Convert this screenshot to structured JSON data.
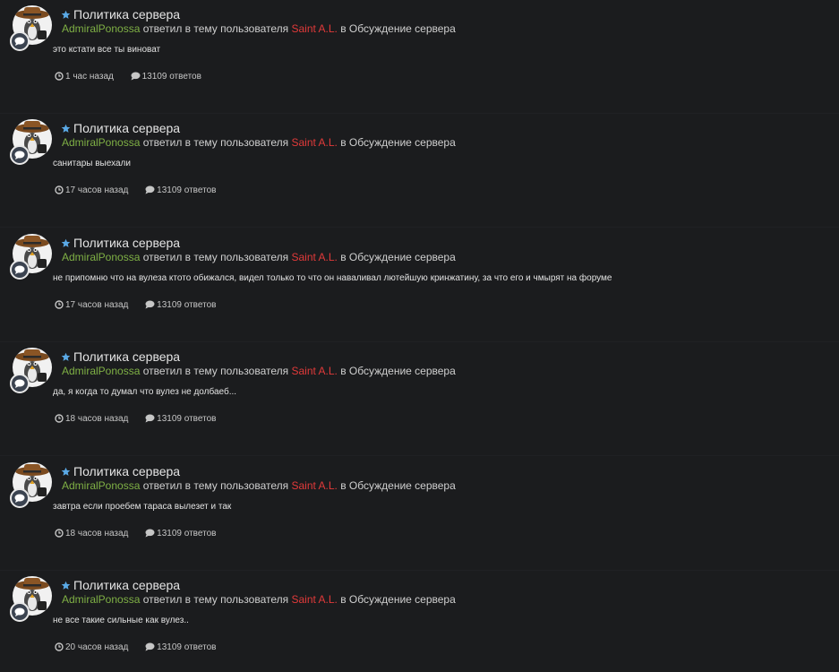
{
  "items": [
    {
      "topic_title": "Политика сервера",
      "author": "AdmiralPonossa",
      "action_text": "ответил в тему пользователя",
      "topic_owner": "Saint A.L.",
      "in_text": "в",
      "forum": "Обсуждение сервера",
      "snippet": "это кстати все ты виноват",
      "time": "1 час назад",
      "replies": "13109 ответов"
    },
    {
      "topic_title": "Политика сервера",
      "author": "AdmiralPonossa",
      "action_text": "ответил в тему пользователя",
      "topic_owner": "Saint A.L.",
      "in_text": "в",
      "forum": "Обсуждение сервера",
      "snippet": "санитары выехали",
      "time": "17 часов назад",
      "replies": "13109 ответов"
    },
    {
      "topic_title": "Политика сервера",
      "author": "AdmiralPonossa",
      "action_text": "ответил в тему пользователя",
      "topic_owner": "Saint A.L.",
      "in_text": "в",
      "forum": "Обсуждение сервера",
      "snippet": "не припомню что на вулеза ктото обижался, видел только то что он наваливал лютейшую кринжатину, за что его и чмырят на форуме",
      "time": "17 часов назад",
      "replies": "13109 ответов"
    },
    {
      "topic_title": "Политика сервера",
      "author": "AdmiralPonossa",
      "action_text": "ответил в тему пользователя",
      "topic_owner": "Saint A.L.",
      "in_text": "в",
      "forum": "Обсуждение сервера",
      "snippet": "да, я когда то думал что вулез не долбаеб...",
      "time": "18 часов назад",
      "replies": "13109 ответов"
    },
    {
      "topic_title": "Политика сервера",
      "author": "AdmiralPonossa",
      "action_text": "ответил в тему пользователя",
      "topic_owner": "Saint A.L.",
      "in_text": "в",
      "forum": "Обсуждение сервера",
      "snippet": "завтра если проебем тараса вылезет и так",
      "time": "18 часов назад",
      "replies": "13109 ответов"
    },
    {
      "topic_title": "Политика сервера",
      "author": "AdmiralPonossa",
      "action_text": "ответил в тему пользователя",
      "topic_owner": "Saint A.L.",
      "in_text": "в",
      "forum": "Обсуждение сервера",
      "snippet": "не все такие сильные как вулез..",
      "time": "20 часов назад",
      "replies": "13109 ответов"
    }
  ],
  "colors": {
    "background": "#1b1c1e",
    "author": "#7fb045",
    "topic_owner": "#e13a3a",
    "star": "#5aa9e6"
  },
  "icons": {
    "featured": "star-icon",
    "badge": "comment-bubble-icon",
    "time": "clock-icon",
    "replies": "comment-icon"
  }
}
